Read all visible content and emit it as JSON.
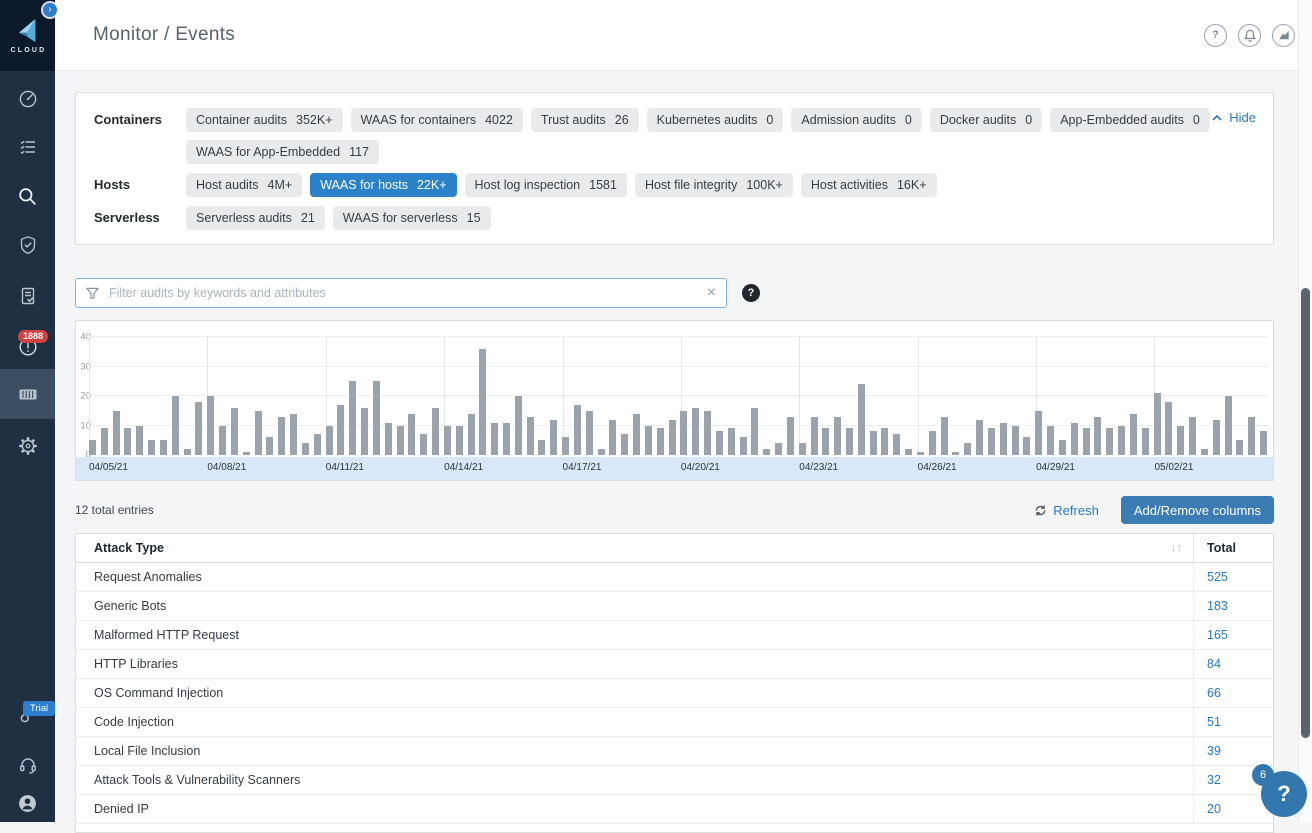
{
  "sidebar": {
    "logo_text": "CLOUD",
    "expand_glyph": "›",
    "alert_badge": "1888",
    "trial_badge": "Trial",
    "nav_icons": [
      "radar-icon",
      "checklist-icon",
      "search-icon",
      "shield-check-icon",
      "compliance-icon",
      "alerts-icon",
      "containers-icon",
      "settings-icon"
    ],
    "bottom_icons": [
      "key-icon",
      "support-icon",
      "user-icon"
    ]
  },
  "header": {
    "title": "Monitor / Events",
    "help_glyph": "?",
    "icons": [
      "help-icon",
      "notifications-icon",
      "usage-icon"
    ]
  },
  "filters_panel": {
    "hide_label": "Hide",
    "rows": [
      {
        "label": "Containers",
        "lines": [
          [
            {
              "name": "Container audits",
              "count": "352K+"
            },
            {
              "name": "WAAS for containers",
              "count": "4022"
            },
            {
              "name": "Trust audits",
              "count": "26"
            },
            {
              "name": "Kubernetes audits",
              "count": "0"
            },
            {
              "name": "Admission audits",
              "count": "0"
            },
            {
              "name": "Docker audits",
              "count": "0"
            },
            {
              "name": "App-Embedded audits",
              "count": "0"
            }
          ],
          [
            {
              "name": "WAAS for App-Embedded",
              "count": "117"
            }
          ]
        ]
      },
      {
        "label": "Hosts",
        "lines": [
          [
            {
              "name": "Host audits",
              "count": "4M+"
            },
            {
              "name": "WAAS for hosts",
              "count": "22K+",
              "selected": true
            },
            {
              "name": "Host log inspection",
              "count": "1581"
            },
            {
              "name": "Host file integrity",
              "count": "100K+"
            },
            {
              "name": "Host activities",
              "count": "16K+"
            }
          ]
        ]
      },
      {
        "label": "Serverless",
        "lines": [
          [
            {
              "name": "Serverless audits",
              "count": "21"
            },
            {
              "name": "WAAS for serverless",
              "count": "15"
            }
          ]
        ]
      }
    ]
  },
  "search": {
    "placeholder": "Filter audits by keywords and attributes",
    "value": "",
    "clear_glyph": "×",
    "help_glyph": "?"
  },
  "chart_data": {
    "type": "bar",
    "title": "",
    "xlabel": "",
    "ylabel": "",
    "ylim": [
      0,
      40
    ],
    "yticks": [
      0,
      10,
      20,
      30,
      40
    ],
    "grid": true,
    "bar_color": "#9aa2ab",
    "axis_band_color": "#d9e8f8",
    "x_tick_labels": [
      "04/05/21",
      "04/08/21",
      "04/11/21",
      "04/14/21",
      "04/17/21",
      "04/20/21",
      "04/23/21",
      "04/26/21",
      "04/29/21",
      "05/02/21"
    ],
    "tick_every": 10,
    "values": [
      5,
      9,
      15,
      9,
      10,
      5,
      5,
      20,
      2,
      18,
      20,
      10,
      16,
      1,
      15,
      6,
      13,
      14,
      4,
      7,
      10,
      17,
      25,
      16,
      25,
      11,
      10,
      14,
      7,
      16,
      10,
      10,
      14,
      36,
      11,
      11,
      20,
      13,
      5,
      12,
      6,
      17,
      15,
      2,
      12,
      7,
      14,
      10,
      9,
      12,
      15,
      16,
      15,
      8,
      9,
      6,
      16,
      2,
      4,
      13,
      4,
      13,
      9,
      13,
      9,
      24,
      8,
      9,
      7,
      2,
      1,
      8,
      13,
      1,
      4,
      12,
      9,
      11,
      10,
      6,
      15,
      10,
      5,
      11,
      9,
      13,
      9,
      10,
      14,
      9,
      21,
      18,
      10,
      13,
      2,
      12,
      20,
      5,
      13,
      8
    ]
  },
  "toolbar": {
    "total_entries": "12 total entries",
    "refresh_label": "Refresh",
    "add_remove_label": "Add/Remove columns"
  },
  "table": {
    "columns": [
      "Attack Type",
      "Total"
    ],
    "sort_glyph": "↓↑",
    "rows": [
      {
        "attack_type": "Request Anomalies",
        "total": "525"
      },
      {
        "attack_type": "Generic Bots",
        "total": "183"
      },
      {
        "attack_type": "Malformed HTTP Request",
        "total": "165"
      },
      {
        "attack_type": "HTTP Libraries",
        "total": "84"
      },
      {
        "attack_type": "OS Command Injection",
        "total": "66"
      },
      {
        "attack_type": "Code Injection",
        "total": "51"
      },
      {
        "attack_type": "Local File Inclusion",
        "total": "39"
      },
      {
        "attack_type": "Attack Tools & Vulnerability Scanners",
        "total": "32"
      },
      {
        "attack_type": "Denied IP",
        "total": "20"
      }
    ]
  },
  "floating_help": {
    "glyph": "?",
    "badge": "6"
  },
  "colors": {
    "sidebar_bg": "#202f42",
    "selected_chip_blue": "#2c82c8",
    "link_blue": "#2878c0",
    "button_blue": "#3a7cb3",
    "badge_red": "#ce4242",
    "trial_blue": "#2e7fd1",
    "bar_gray": "#9aa2ab",
    "axis_band_blue": "#d9e8f8"
  }
}
